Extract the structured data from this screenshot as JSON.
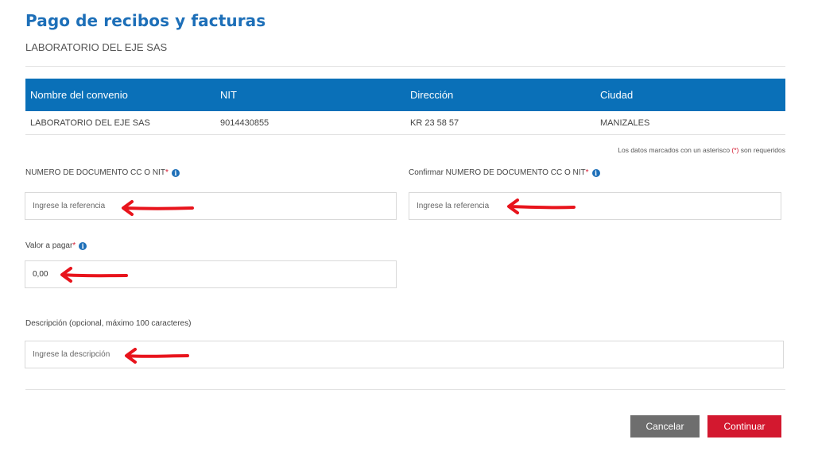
{
  "header": {
    "title": "Pago de recibos y facturas",
    "company": "LABORATORIO DEL EJE SAS"
  },
  "table": {
    "columns": [
      "Nombre del convenio",
      "NIT",
      "Dirección",
      "Ciudad"
    ],
    "rows": [
      [
        "LABORATORIO DEL EJE SAS",
        "9014430855",
        "KR 23 58 57",
        "MANIZALES"
      ]
    ]
  },
  "required_note": {
    "before": "Los datos marcados con un asterisco ",
    "asterisk": "(*)",
    "after": " son requeridos"
  },
  "form": {
    "document": {
      "label": "NUMERO DE DOCUMENTO CC O NIT",
      "required": "*",
      "placeholder": "Ingrese la referencia"
    },
    "confirm_document": {
      "label": "Confirmar NUMERO DE DOCUMENTO CC O NIT",
      "required": "*",
      "placeholder": "Ingrese la referencia"
    },
    "amount": {
      "label": "Valor a pagar",
      "required": "*",
      "value": "0,00"
    },
    "description": {
      "label": "Descripción (opcional, máximo 100 caracteres)",
      "placeholder": "Ingrese la descripción"
    }
  },
  "info_icon_glyph": "i",
  "buttons": {
    "cancel": "Cancelar",
    "continue": "Continuar"
  },
  "colors": {
    "primary": "#0a70b8",
    "title": "#1d6fb8",
    "danger": "#d3182f",
    "cancel": "#6e6e6e",
    "annotation_arrow": "#e8141c"
  },
  "icons": [
    "info-icon",
    "annotation-arrow"
  ]
}
